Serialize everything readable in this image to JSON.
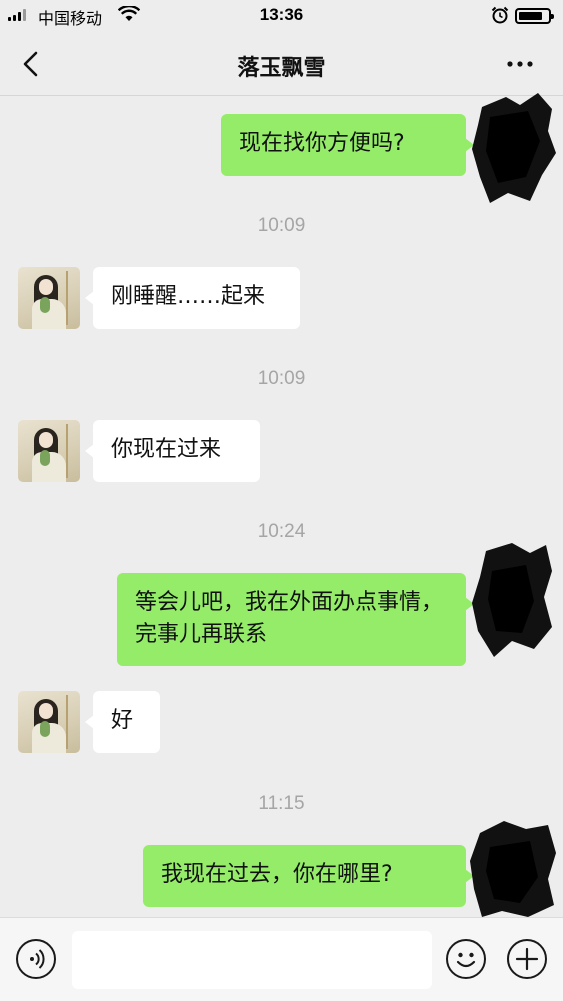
{
  "status_bar": {
    "carrier": "中国移动",
    "time": "13:36",
    "battery_level": 0.82
  },
  "header": {
    "title": "落玉飘雪",
    "back_icon": "chevron-left-icon",
    "more_icon": "more-dots-icon"
  },
  "messages": [
    {
      "type": "message",
      "direction": "out",
      "text": "现在找你方便吗?"
    },
    {
      "type": "timestamp",
      "text": "10:09"
    },
    {
      "type": "message",
      "direction": "in",
      "text": "刚睡醒……起来"
    },
    {
      "type": "timestamp",
      "text": "10:09"
    },
    {
      "type": "message",
      "direction": "in",
      "text": "你现在过来"
    },
    {
      "type": "timestamp",
      "text": "10:24"
    },
    {
      "type": "message",
      "direction": "out",
      "text": "等会儿吧，我在外面办点事情，完事儿再联系"
    },
    {
      "type": "message",
      "direction": "in",
      "text": "好"
    },
    {
      "type": "timestamp",
      "text": "11:15"
    },
    {
      "type": "message",
      "direction": "out",
      "text": "我现在过去，你在哪里?"
    }
  ],
  "input_bar": {
    "voice_icon": "voice-icon",
    "text_value": "",
    "emoji_icon": "emoji-icon",
    "plus_icon": "plus-icon"
  },
  "colors": {
    "background": "#ededed",
    "bubble_out": "#95ec69",
    "bubble_in": "#ffffff",
    "timestamp": "#a5a5a5"
  }
}
